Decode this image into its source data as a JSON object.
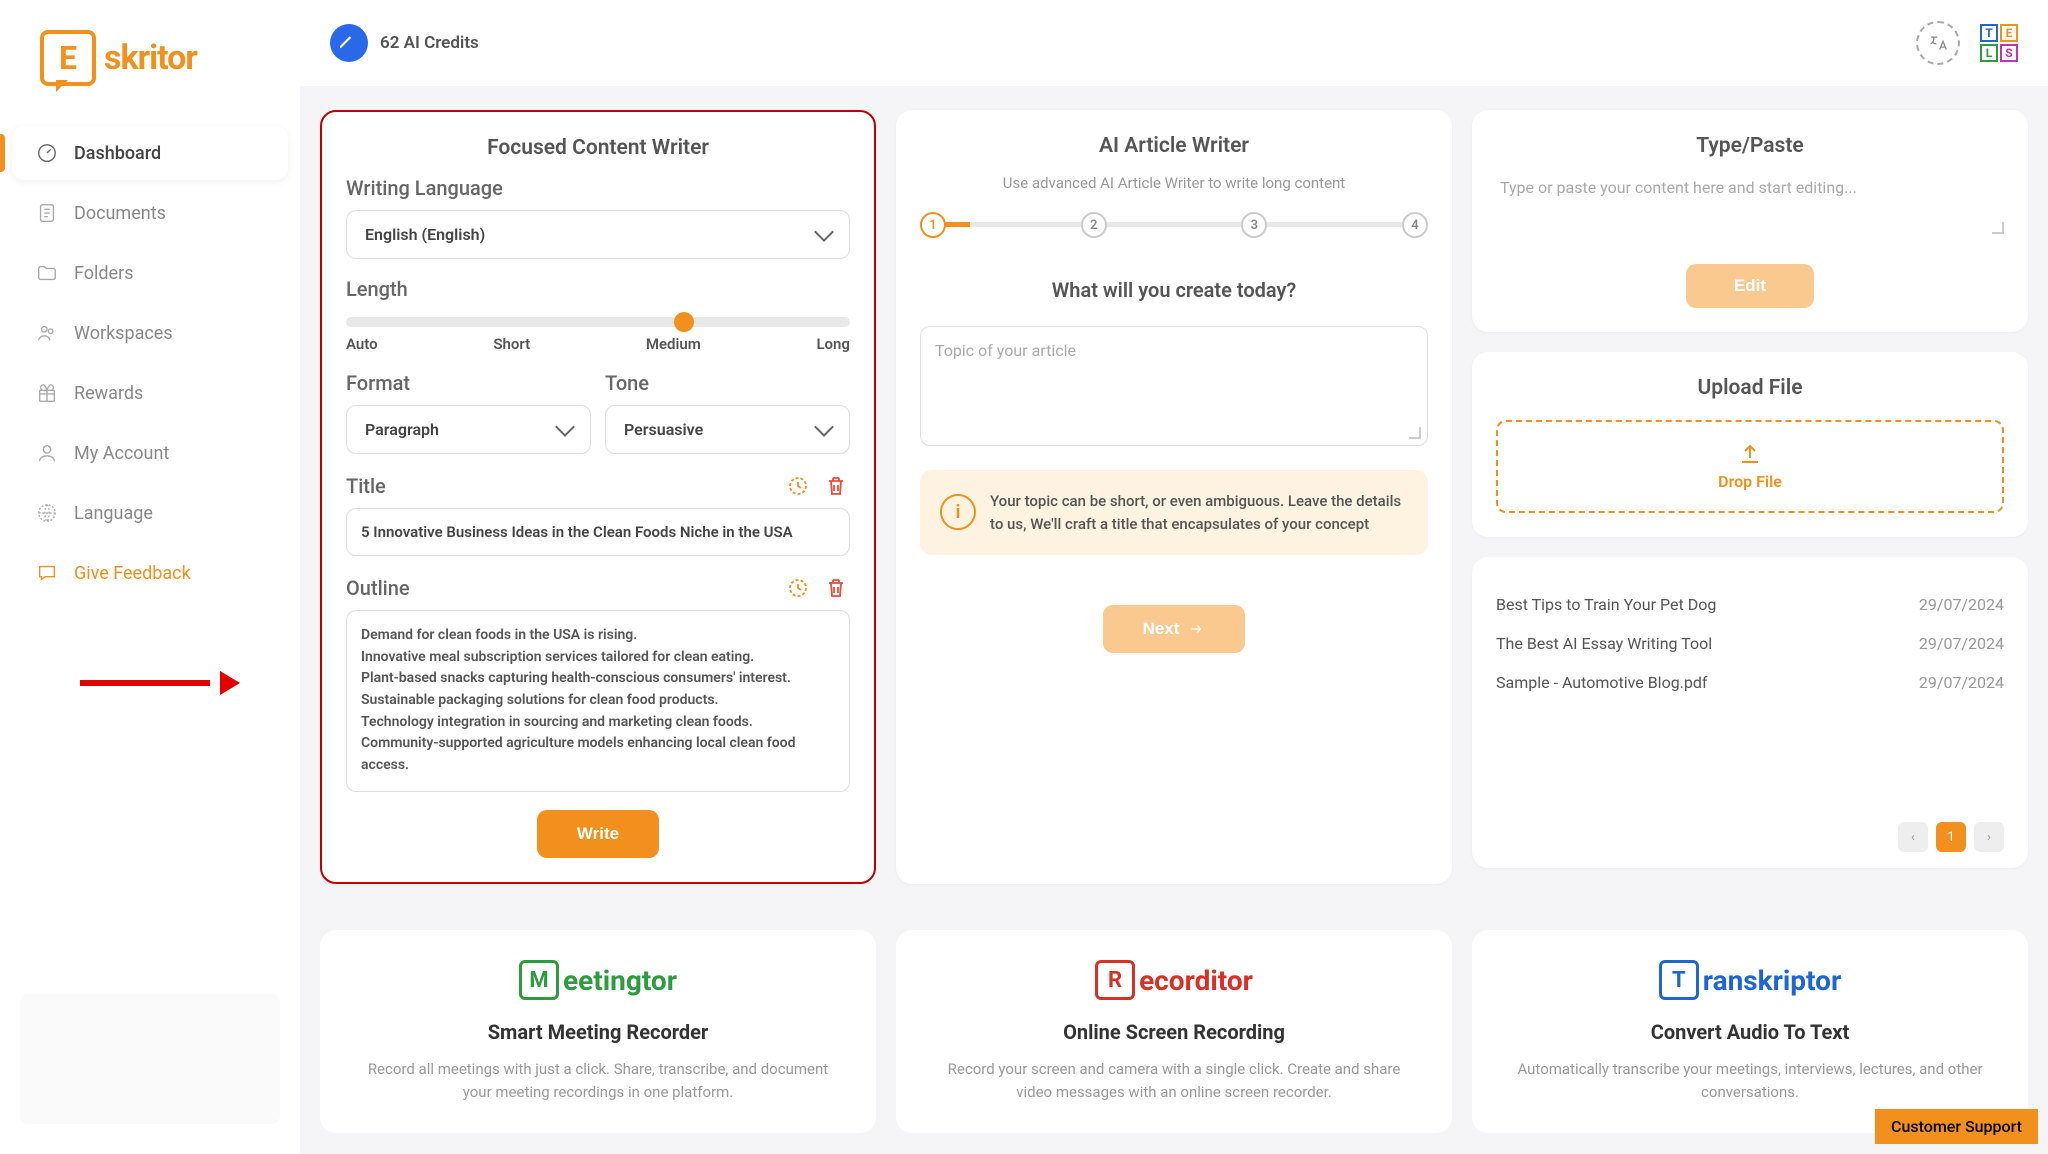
{
  "brand": "skritor",
  "topbar": {
    "credits": "62 AI Credits"
  },
  "sidebar": {
    "items": [
      {
        "label": "Dashboard"
      },
      {
        "label": "Documents"
      },
      {
        "label": "Folders"
      },
      {
        "label": "Workspaces"
      },
      {
        "label": "Rewards"
      },
      {
        "label": "My Account"
      },
      {
        "label": "Language"
      },
      {
        "label": "Give Feedback"
      }
    ]
  },
  "focused": {
    "title": "Focused Content Writer",
    "lang_label": "Writing Language",
    "lang_value": "English (English)",
    "length_label": "Length",
    "length_ticks": [
      "Auto",
      "Short",
      "Medium",
      "Long"
    ],
    "format_label": "Format",
    "format_value": "Paragraph",
    "tone_label": "Tone",
    "tone_value": "Persuasive",
    "title_label": "Title",
    "title_value": "5 Innovative Business Ideas in the Clean Foods Niche in the USA",
    "outline_label": "Outline",
    "outline_text": "Demand for clean foods in the USA is rising.\nInnovative meal subscription services tailored for clean eating.\nPlant-based snacks capturing health-conscious consumers' interest.\nSustainable packaging solutions for clean food products.\nTechnology integration in sourcing and marketing clean foods.\nCommunity-supported agriculture models enhancing local clean food access.",
    "write_btn": "Write"
  },
  "article": {
    "title": "AI Article Writer",
    "sub": "Use advanced AI Article Writer to write long content",
    "steps": [
      "1",
      "2",
      "3",
      "4"
    ],
    "prompt": "What will you create today?",
    "placeholder": "Topic of your article",
    "hint": "Your topic can be short, or even ambiguous. Leave the details to us, We'll craft a title that encapsulates of your concept",
    "next_btn": "Next"
  },
  "typepaste": {
    "title": "Type/Paste",
    "placeholder": "Type or paste your content here and start editing...",
    "edit_btn": "Edit"
  },
  "upload": {
    "title": "Upload File",
    "drop": "Drop File"
  },
  "docs": [
    {
      "name": "Best Tips to Train Your Pet Dog",
      "date": "29/07/2024"
    },
    {
      "name": "The Best AI Essay Writing Tool",
      "date": "29/07/2024"
    },
    {
      "name": "Sample - Automotive Blog.pdf",
      "date": "29/07/2024"
    }
  ],
  "pager": {
    "current": "1"
  },
  "promos": [
    {
      "logo": "eetingtor",
      "letter": "M",
      "color": "#2E9B3F",
      "title": "Smart Meeting Recorder",
      "desc": "Record all meetings with just a click. Share, transcribe, and document your meeting recordings in one platform."
    },
    {
      "logo": "ecorditor",
      "letter": "R",
      "color": "#D93025",
      "title": "Online Screen Recording",
      "desc": "Record your screen and camera with a single click. Create and share video messages with an online screen recorder."
    },
    {
      "logo": "ranskriptor",
      "letter": "T",
      "color": "#1E66D0",
      "title": "Convert Audio To Text",
      "desc": "Automatically transcribe your meetings, interviews, lectures, and other conversations."
    }
  ],
  "support": "Customer Support"
}
